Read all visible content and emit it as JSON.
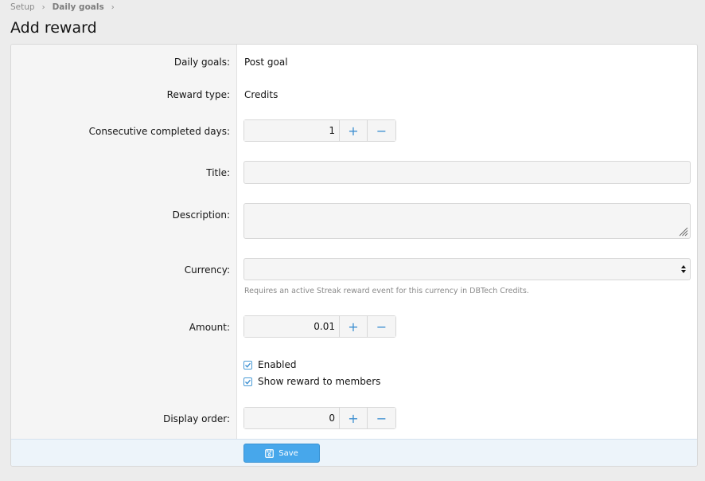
{
  "breadcrumb": {
    "items": [
      {
        "label": "Setup"
      },
      {
        "label": "Daily goals"
      }
    ]
  },
  "page": {
    "title": "Add reward"
  },
  "form": {
    "daily_goals": {
      "label": "Daily goals:",
      "value": "Post goal"
    },
    "reward_type": {
      "label": "Reward type:",
      "value": "Credits"
    },
    "consecutive_days": {
      "label": "Consecutive completed days:",
      "value": "1",
      "plus": "+",
      "minus": "−"
    },
    "title": {
      "label": "Title:",
      "value": ""
    },
    "description": {
      "label": "Description:",
      "value": ""
    },
    "currency": {
      "label": "Currency:",
      "value": "",
      "hint": "Requires an active Streak reward event for this currency in DBTech Credits."
    },
    "amount": {
      "label": "Amount:",
      "value": "0.01",
      "plus": "+",
      "minus": "−"
    },
    "enabled": {
      "label": "Enabled",
      "checked": true
    },
    "show_to_members": {
      "label": "Show reward to members",
      "checked": true
    },
    "display_order": {
      "label": "Display order:",
      "value": "0",
      "plus": "+",
      "minus": "−"
    }
  },
  "footer": {
    "save_label": "Save",
    "save_icon": "save-icon"
  },
  "colors": {
    "accent": "#47a7eb",
    "icon_blue": "#3d8fd1",
    "footer_bg": "#edf4fa"
  }
}
